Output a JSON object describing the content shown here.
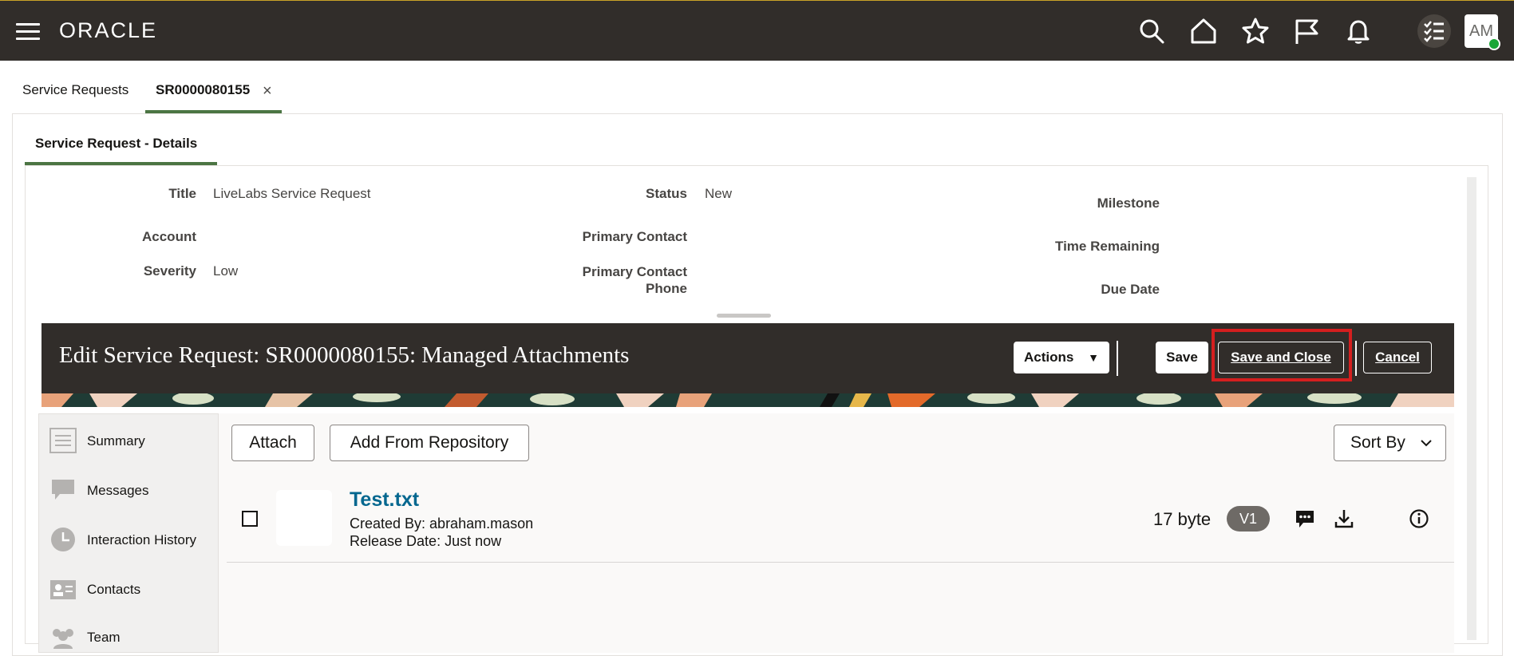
{
  "app": {
    "brand": "ORACLE",
    "user_initials": "AM",
    "colors": {
      "header_bg": "#312d2a",
      "accent_green": "#4b7543",
      "link_blue": "#04678f",
      "highlight_red": "#d41f1f"
    }
  },
  "header_icons": [
    "menu-icon",
    "search-icon",
    "home-icon",
    "favorites-star-icon",
    "flag-icon",
    "notifications-bell-icon",
    "tasks-icon"
  ],
  "tabs": [
    {
      "label": "Service Requests",
      "active": false
    },
    {
      "label": "SR0000080155",
      "active": true,
      "close": "×"
    }
  ],
  "subtab": {
    "label": "Service Request - Details"
  },
  "details": {
    "title_label": "Title",
    "title_value": "LiveLabs Service Request",
    "account_label": "Account",
    "account_value": "",
    "severity_label": "Severity",
    "severity_value": "Low",
    "status_label": "Status",
    "status_value": "New",
    "primary_contact_label": "Primary Contact",
    "primary_contact_value": "",
    "primary_contact_phone_label": "Primary Contact Phone",
    "milestone_label": "Milestone",
    "time_remaining_label": "Time Remaining",
    "due_date_label": "Due Date"
  },
  "dialog": {
    "title": "Edit Service Request: SR0000080155: Managed Attachments",
    "actions_label": "Actions",
    "save_label": "Save",
    "save_close_label": "Save and Close",
    "cancel_label": "Cancel"
  },
  "side_nav": [
    {
      "label": "Summary",
      "icon": "summary-list-icon"
    },
    {
      "label": "Messages",
      "icon": "messages-icon"
    },
    {
      "label": "Interaction History",
      "icon": "clock-icon"
    },
    {
      "label": "Contacts",
      "icon": "contact-card-icon"
    },
    {
      "label": "Team",
      "icon": "team-icon"
    }
  ],
  "attachments": {
    "attach_label": "Attach",
    "add_repo_label": "Add From Repository",
    "sort_label": "Sort By",
    "items": [
      {
        "name": "Test.txt",
        "created_by": "Created By: abraham.mason",
        "release_date": "Release Date: Just now",
        "size": "17 byte",
        "version": "V1"
      }
    ]
  }
}
